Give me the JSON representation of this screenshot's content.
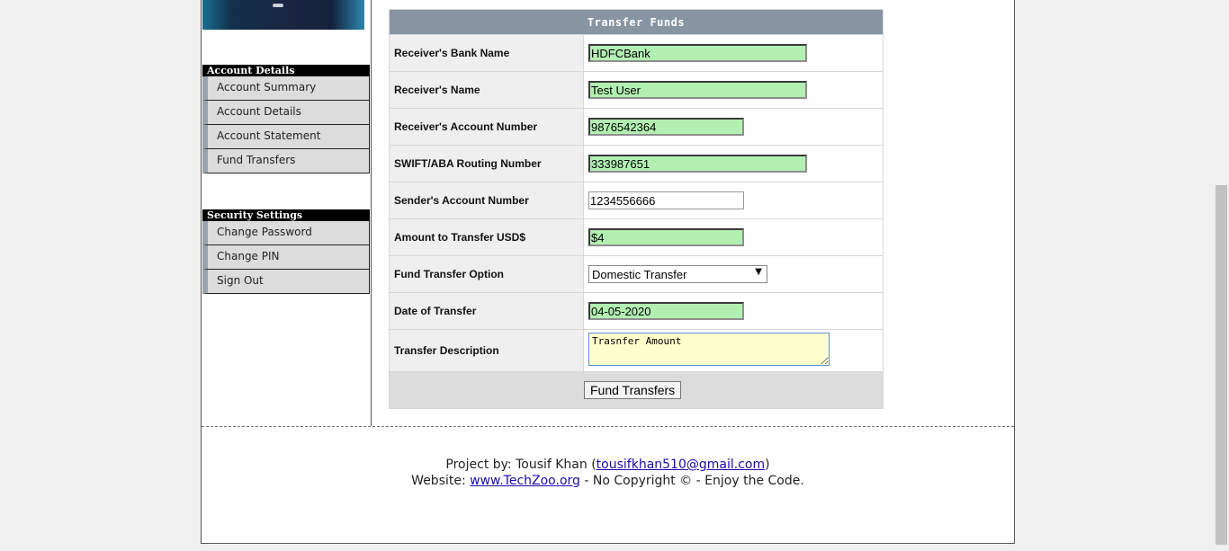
{
  "sidebar": {
    "account_header": "Account Details",
    "account_items": [
      {
        "label": "Account Summary"
      },
      {
        "label": "Account Details"
      },
      {
        "label": "Account Statement"
      },
      {
        "label": "Fund Transfers"
      }
    ],
    "security_header": "Security Settings",
    "security_items": [
      {
        "label": "Change Password"
      },
      {
        "label": "Change PIN"
      },
      {
        "label": "Sign Out"
      }
    ]
  },
  "form": {
    "title": "Transfer Funds",
    "fields": {
      "bank_name": {
        "label": "Receiver's Bank Name",
        "value": "HDFCBank"
      },
      "receiver_name": {
        "label": "Receiver's Name",
        "value": "Test User"
      },
      "account_number": {
        "label": "Receiver's Account Number",
        "value": "9876542364"
      },
      "routing_number": {
        "label": "SWIFT/ABA Routing Number",
        "value": "333987651"
      },
      "sender_account": {
        "label": "Sender's Account Number",
        "value": "1234556666"
      },
      "amount": {
        "label": "Amount to Transfer USD$",
        "value": "$4"
      },
      "option": {
        "label": "Fund Transfer Option",
        "value": "Domestic Transfer"
      },
      "date": {
        "label": "Date of Transfer",
        "value": "04-05-2020"
      },
      "description": {
        "label": "Transfer Description",
        "value": "Trasnfer Amount"
      }
    },
    "submit_label": "Fund Transfers"
  },
  "footer": {
    "line1_prefix": "Project by: Tousif Khan (",
    "email": "tousifkhan510@gmail.com",
    "line1_suffix": ")",
    "line2_prefix": "Website: ",
    "website": "www.TechZoo.org",
    "line2_suffix": " - No Copyright © - Enjoy the Code."
  },
  "colors": {
    "autofill_green": "#b2f0b2",
    "header_slate": "#8795a3",
    "textarea_yellow": "#ffffcc"
  }
}
